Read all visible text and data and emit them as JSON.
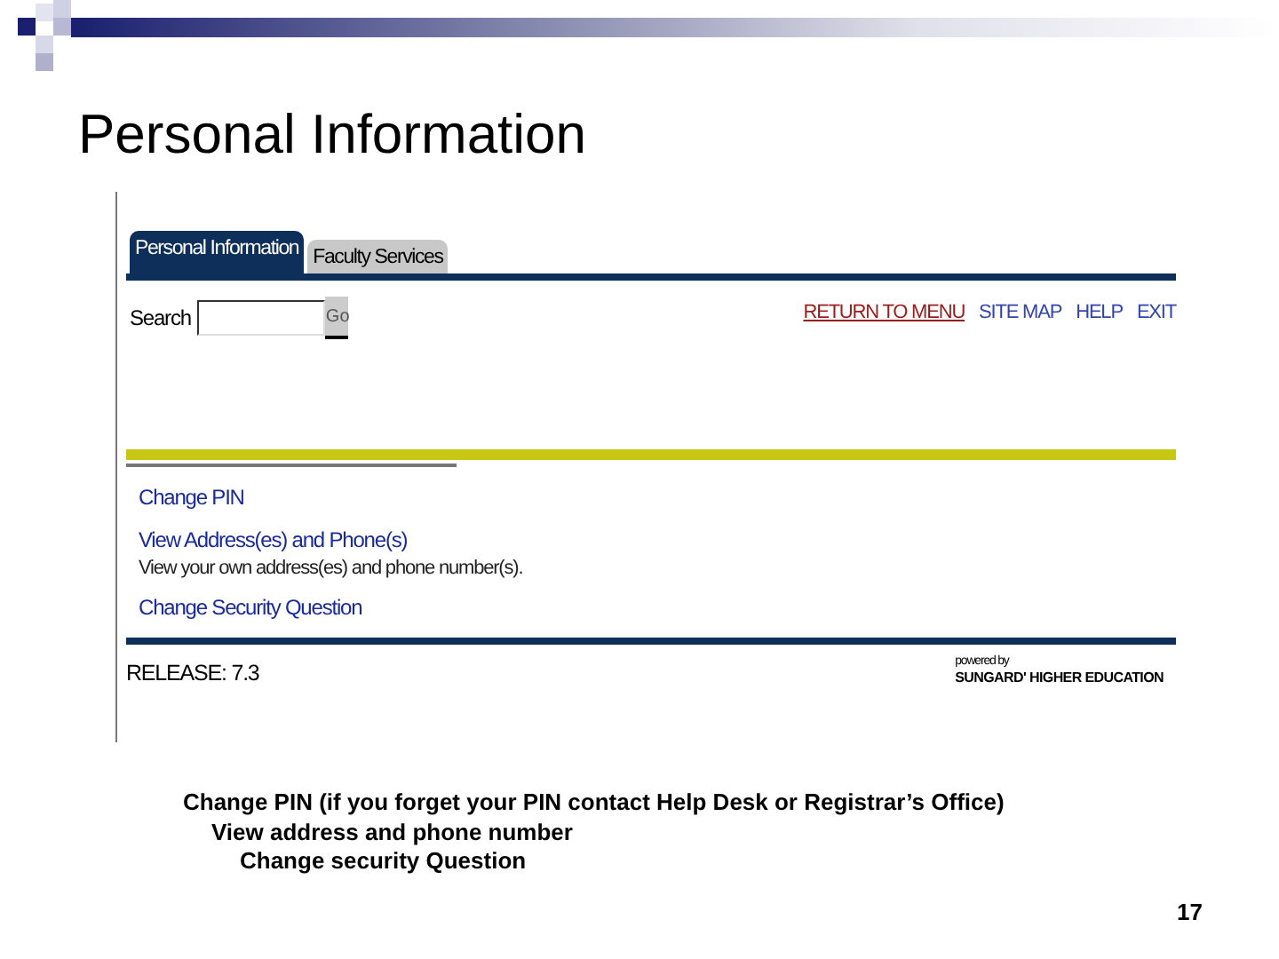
{
  "slide_title": "Personal Information",
  "screenshot": {
    "tabs": [
      {
        "label": "Personal Information",
        "selected": true
      },
      {
        "label": "Faculty Services",
        "selected": false
      }
    ],
    "search": {
      "label": "Search",
      "button": "Go"
    },
    "top_links": [
      {
        "label": "RETURN TO MENU",
        "kind": "primary"
      },
      {
        "label": "SITE MAP",
        "kind": "plain"
      },
      {
        "label": "HELP",
        "kind": "plain"
      },
      {
        "label": "EXIT",
        "kind": "plain"
      }
    ],
    "menu": [
      {
        "label": "Change PIN"
      },
      {
        "label": "View Address(es) and Phone(s)",
        "description": "View your own address(es) and phone number(s)."
      },
      {
        "label": "Change Security Question"
      }
    ],
    "release": "RELEASE: 7.3",
    "powered_by": "powered by",
    "vendor": "SUNGARD' HIGHER EDUCATION"
  },
  "notes": [
    {
      "text": "Change PIN (if you forget your PIN contact Help Desk or Registrar’s Office)",
      "children": [
        {
          "text": "View address and phone number",
          "children": [
            {
              "text": "Change security Question"
            }
          ]
        }
      ]
    }
  ],
  "page_number": "17"
}
